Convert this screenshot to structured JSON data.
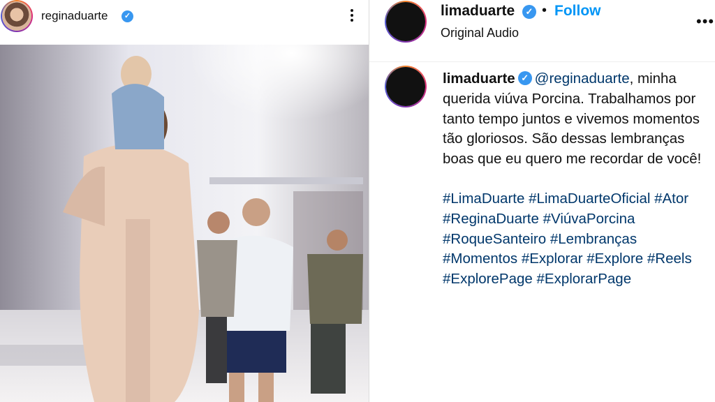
{
  "left_post": {
    "username": "reginaduarte",
    "verified_mark": "✓",
    "more_icon": "more-vertical-icon"
  },
  "right_post": {
    "username": "limaduarte",
    "verified_mark": "✓",
    "separator": "•",
    "follow_label": "Follow",
    "audio_label": "Original Audio",
    "more_label": "•••",
    "caption": {
      "username": "limaduarte",
      "mention": "@reginaduarte",
      "text": ", minha querida viúva Porcina. Trabalhamos por tanto tempo juntos e vivemos momentos tão gloriosos. São dessas lembranças boas que eu quero me recordar de você!",
      "hashtags": [
        "#LimaDuarte",
        "#LimaDuarteOficial",
        "#Ator",
        "#ReginaDuarte",
        "#ViúvaPorcina",
        "#RoqueSanteiro",
        "#Lembranças",
        "#Momentos",
        "#Explorar",
        "#Explore",
        "#Reels",
        "#ExplorePage",
        "#ExplorarPage"
      ]
    }
  },
  "colors": {
    "follow": "#0095f6",
    "hashtag": "#00376b",
    "verified": "#3897f0"
  }
}
